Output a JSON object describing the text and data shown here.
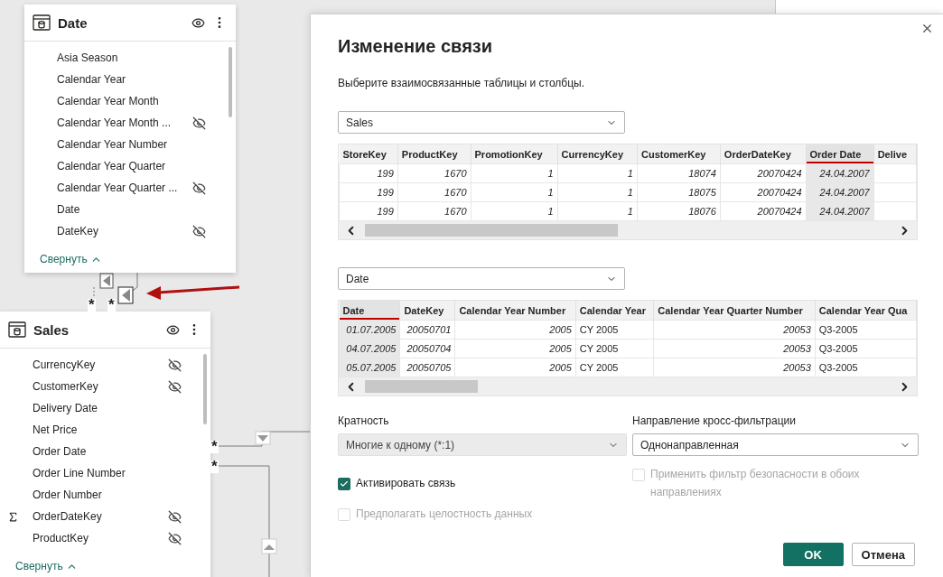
{
  "canvas": {
    "tables": [
      {
        "title": "Date",
        "fields": [
          {
            "name": "Asia Season",
            "hidden": false,
            "summarized": false
          },
          {
            "name": "Calendar Year",
            "hidden": false,
            "summarized": false
          },
          {
            "name": "Calendar Year Month",
            "hidden": false,
            "summarized": false
          },
          {
            "name": "Calendar Year Month ...",
            "hidden": true,
            "summarized": false
          },
          {
            "name": "Calendar Year Number",
            "hidden": false,
            "summarized": false
          },
          {
            "name": "Calendar Year Quarter",
            "hidden": false,
            "summarized": false
          },
          {
            "name": "Calendar Year Quarter ...",
            "hidden": true,
            "summarized": false
          },
          {
            "name": "Date",
            "hidden": false,
            "summarized": false
          },
          {
            "name": "DateKey",
            "hidden": true,
            "summarized": false
          }
        ],
        "collapse": "Свернуть"
      },
      {
        "title": "Sales",
        "fields": [
          {
            "name": "CurrencyKey",
            "hidden": true,
            "summarized": false
          },
          {
            "name": "CustomerKey",
            "hidden": true,
            "summarized": false
          },
          {
            "name": "Delivery Date",
            "hidden": false,
            "summarized": false
          },
          {
            "name": "Net Price",
            "hidden": false,
            "summarized": false
          },
          {
            "name": "Order Date",
            "hidden": false,
            "summarized": false
          },
          {
            "name": "Order Line Number",
            "hidden": false,
            "summarized": false
          },
          {
            "name": "Order Number",
            "hidden": false,
            "summarized": false
          },
          {
            "name": "OrderDateKey",
            "hidden": true,
            "summarized": true
          },
          {
            "name": "ProductKey",
            "hidden": true,
            "summarized": false
          }
        ],
        "collapse": "Свернуть"
      }
    ],
    "markers": [
      "*",
      "*",
      "*",
      "*"
    ]
  },
  "dialog": {
    "title": "Изменение связи",
    "subtitle": "Выберите взаимосвязанные таблицы и столбцы.",
    "tables": [
      {
        "dropdown": "Sales",
        "columns": [
          {
            "label": "StoreKey",
            "kind": "number",
            "selected": false
          },
          {
            "label": "ProductKey",
            "kind": "number",
            "selected": false
          },
          {
            "label": "PromotionKey",
            "kind": "number",
            "selected": false
          },
          {
            "label": "CurrencyKey",
            "kind": "number",
            "selected": false
          },
          {
            "label": "CustomerKey",
            "kind": "number",
            "selected": false
          },
          {
            "label": "OrderDateKey",
            "kind": "number",
            "selected": false
          },
          {
            "label": "Order Date",
            "kind": "number",
            "selected": true
          },
          {
            "label": "Delive",
            "kind": "text",
            "selected": false
          }
        ],
        "rows": [
          [
            "199",
            "1670",
            "1",
            "1",
            "18074",
            "20070424",
            "24.04.2007",
            ""
          ],
          [
            "199",
            "1670",
            "1",
            "1",
            "18075",
            "20070424",
            "24.04.2007",
            ""
          ],
          [
            "199",
            "1670",
            "1",
            "1",
            "18076",
            "20070424",
            "24.04.2007",
            ""
          ]
        ]
      },
      {
        "dropdown": "Date",
        "columns": [
          {
            "label": "Date",
            "kind": "number",
            "selected": true
          },
          {
            "label": "DateKey",
            "kind": "number",
            "selected": false
          },
          {
            "label": "Calendar Year Number",
            "kind": "number",
            "selected": false
          },
          {
            "label": "Calendar Year",
            "kind": "text",
            "selected": false
          },
          {
            "label": "Calendar Year Quarter Number",
            "kind": "number",
            "selected": false
          },
          {
            "label": "Calendar Year Qua",
            "kind": "text",
            "selected": false
          }
        ],
        "rows": [
          [
            "01.07.2005",
            "20050701",
            "2005",
            "CY 2005",
            "20053",
            "Q3-2005"
          ],
          [
            "04.07.2005",
            "20050704",
            "2005",
            "CY 2005",
            "20053",
            "Q3-2005"
          ],
          [
            "05.07.2005",
            "20050705",
            "2005",
            "CY 2005",
            "20053",
            "Q3-2005"
          ]
        ]
      }
    ],
    "cardinality": {
      "label": "Кратность",
      "value": "Многие к одному (*:1)",
      "disabled": true
    },
    "direction": {
      "label": "Направление кросс-фильтрации",
      "value": "Однонаправленная",
      "disabled": false
    },
    "options_left": [
      {
        "label": "Активировать связь",
        "checked": true,
        "disabled": false
      },
      {
        "label": "Предполагать целостность данных",
        "checked": false,
        "disabled": true
      }
    ],
    "options_right": [
      {
        "label": "Применить фильтр безопасности в обоих направлениях",
        "checked": false,
        "disabled": true
      }
    ],
    "buttons": [
      {
        "label": "OK",
        "kind": "primary"
      },
      {
        "label": "Отмена",
        "kind": "secondary"
      }
    ]
  }
}
